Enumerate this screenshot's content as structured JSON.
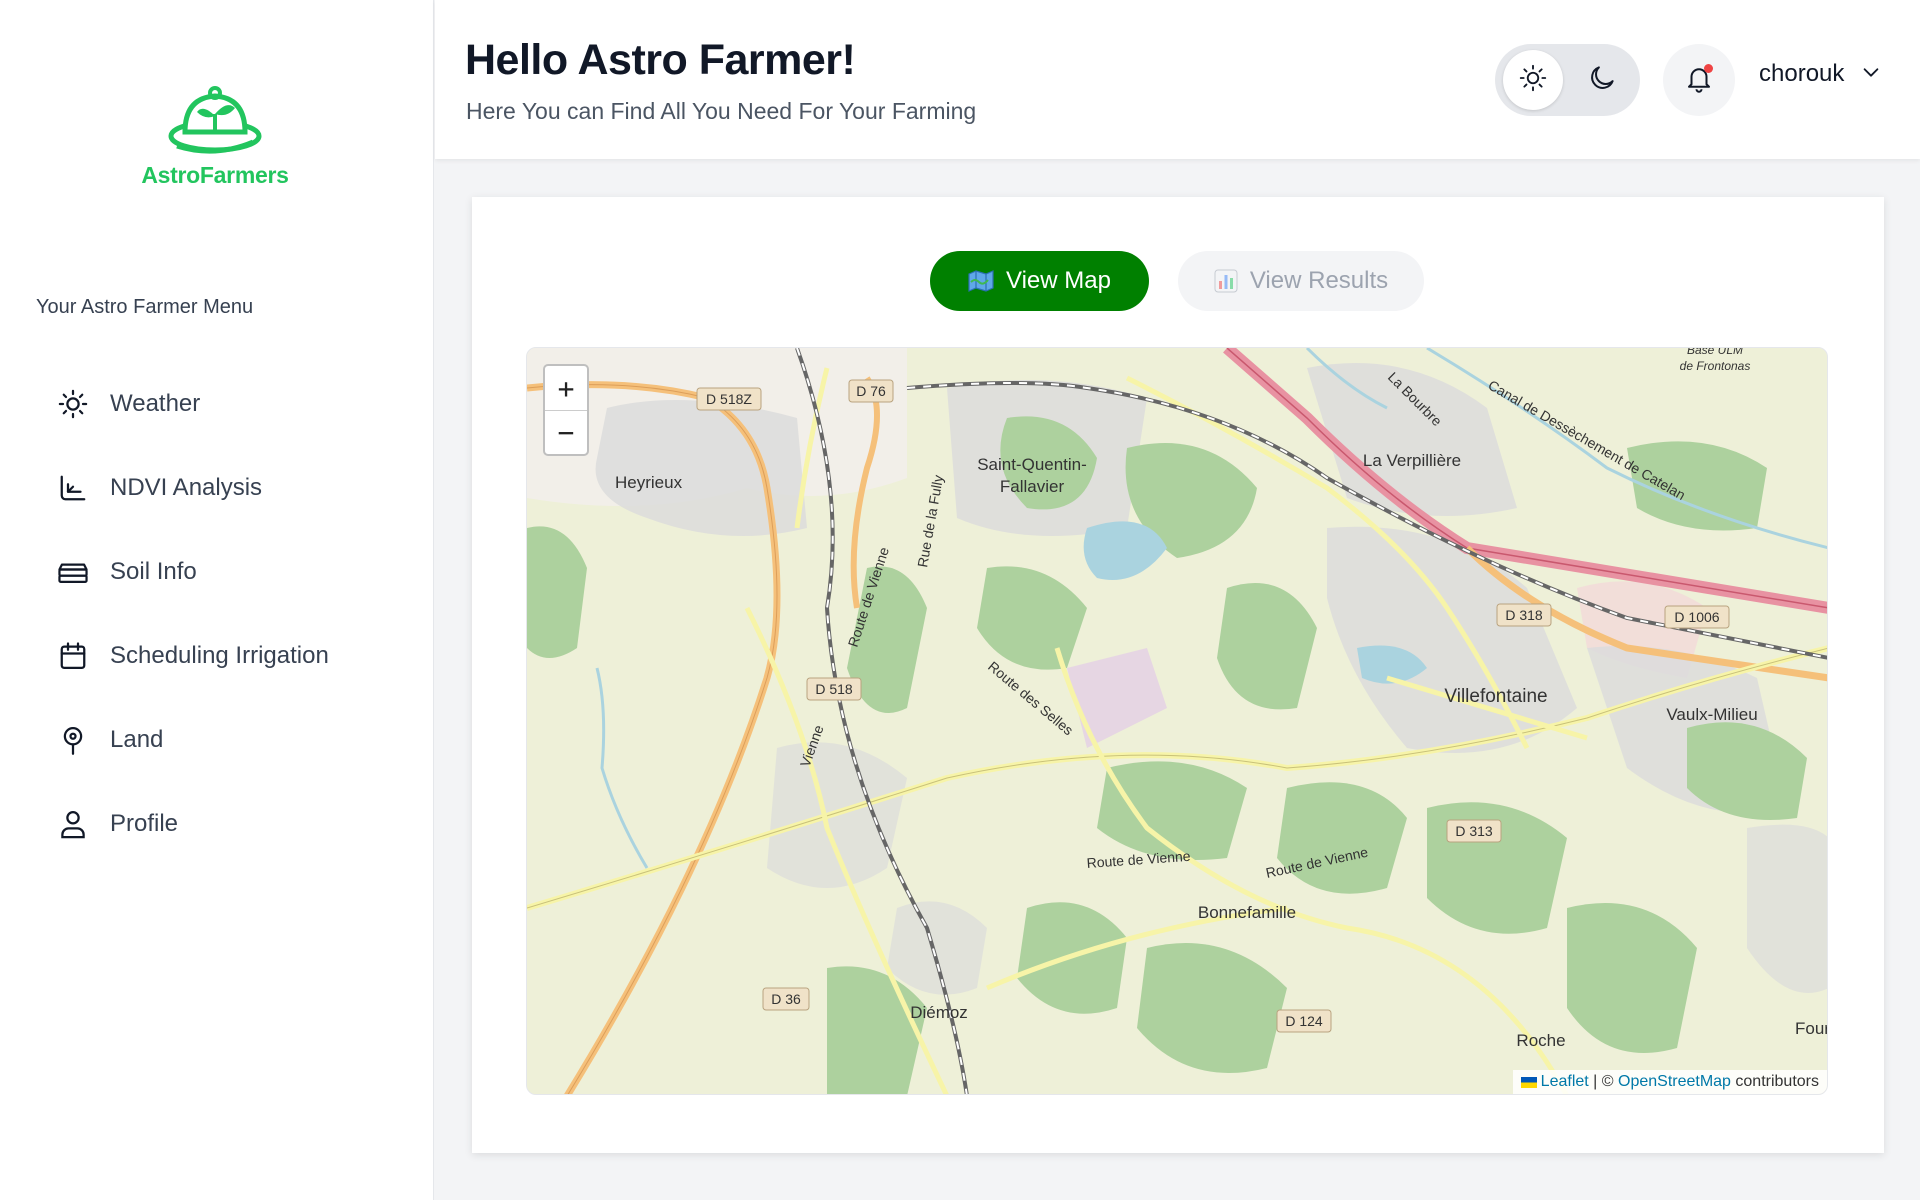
{
  "brand": {
    "name": "AstroFarmers",
    "color": "#22c55e"
  },
  "sidebar": {
    "heading": "Your Astro Farmer Menu",
    "items": [
      {
        "label": "Weather",
        "icon": "sun-icon"
      },
      {
        "label": "NDVI Analysis",
        "icon": "ndvi-chart-icon"
      },
      {
        "label": "Soil Info",
        "icon": "soil-layers-icon"
      },
      {
        "label": "Scheduling Irrigation",
        "icon": "calendar-icon"
      },
      {
        "label": "Land",
        "icon": "map-pin-icon"
      },
      {
        "label": "Profile",
        "icon": "user-icon"
      }
    ]
  },
  "header": {
    "greeting": "Hello Astro Farmer!",
    "subtitle": "Here You can Find All You Need For Your Farming",
    "theme": {
      "active": "light",
      "options": [
        "light",
        "dark"
      ]
    },
    "notifications": {
      "has_unread": true
    },
    "user": {
      "name": "chorouk"
    }
  },
  "tabs": [
    {
      "label": "View Map",
      "icon": "map-emoji-icon",
      "active": true
    },
    {
      "label": "View Results",
      "icon": "bar-chart-emoji-icon",
      "active": false
    }
  ],
  "map": {
    "zoom_in": "+",
    "zoom_out": "−",
    "attribution": {
      "leaflet": "Leaflet",
      "separator": " | © ",
      "osm": "OpenStreetMap",
      "suffix": " contributors"
    },
    "places": {
      "heyrieux": "Heyrieux",
      "saint_quentin_1": "Saint-Quentin-",
      "saint_quentin_2": "Fallavier",
      "la_verpilliere": "La Verpillière",
      "villefontaine": "Villefontaine",
      "vaulx_milieu": "Vaulx-Milieu",
      "bonnefamille": "Bonnefamille",
      "diemoz": "Diémoz",
      "roche": "Roche",
      "four": "Four",
      "base_ulm_1": "Base ULM",
      "base_ulm_2": "de Frontonas"
    },
    "roads": {
      "d518z": "D 518Z",
      "d76": "D 76",
      "d518": "D 518",
      "d318": "D 318",
      "d1006": "D 1006",
      "d313": "D 313",
      "d36": "D 36",
      "d124": "D 124",
      "route_vienne_1": "Route de Vienne",
      "route_vienne_2": "Route de Vienne",
      "route_vienne_3": "Route de Vienne",
      "route_selles": "Route des Selles",
      "rue_fully": "Rue de la Fully",
      "vienne": "Vienne",
      "bourbre": "La Bourbre",
      "canal": "Canal de Dessèchement de Catelan"
    }
  }
}
